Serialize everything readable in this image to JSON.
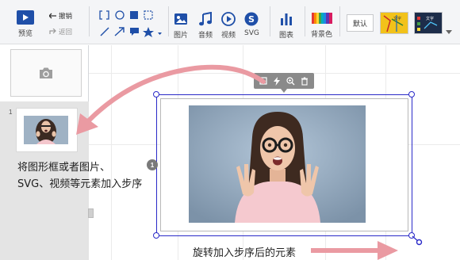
{
  "toolbar": {
    "preview_label": "预览",
    "undo_label": "撤销",
    "back_label": "返回",
    "image_label": "图片",
    "audio_label": "音频",
    "video_label": "视频",
    "svg_label": "SVG",
    "chart_label": "图表",
    "bg_color_label": "背景色",
    "default_label": "默认",
    "theme_text": "文字"
  },
  "left_panel": {
    "slide_number": "1"
  },
  "canvas": {
    "step_badge": "1"
  },
  "annotations": {
    "caption_line1": "将图形框或者图片、",
    "caption_line2": "SVG、视频等元素加入步序",
    "caption_bottom": "旋转加入步序后的元素"
  },
  "colors": {
    "accent_blue": "#1f4fa8",
    "selection_blue": "#2a2ac8",
    "arrow_pink": "#ea9aa2"
  }
}
